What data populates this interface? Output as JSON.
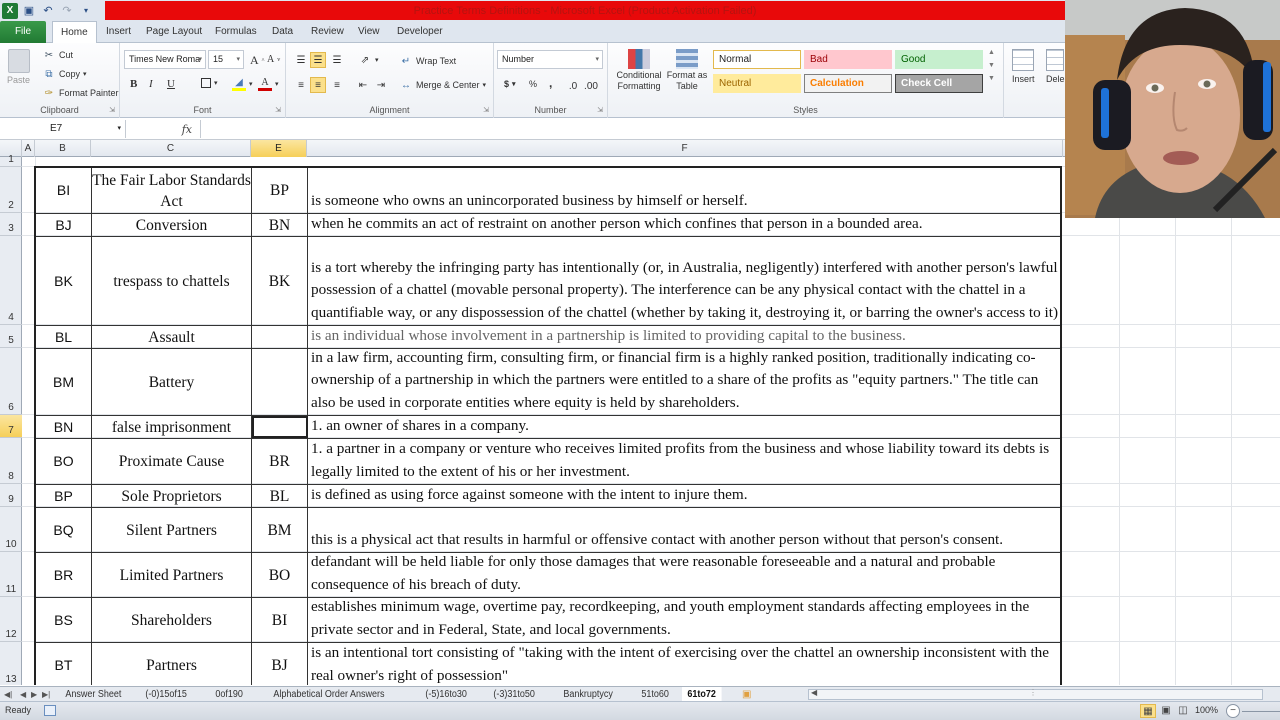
{
  "window": {
    "title": "Practice Terms Definitions - Microsoft Excel (Product Activation Failed)",
    "title_bar_color": "#e8090a"
  },
  "quick_access": {
    "icons": [
      "excel-logo-icon",
      "save-icon",
      "undo-icon",
      "redo-icon",
      "customize-icon"
    ]
  },
  "ribbon_tabs": [
    {
      "label": "File"
    },
    {
      "label": "Home"
    },
    {
      "label": "Insert"
    },
    {
      "label": "Page Layout"
    },
    {
      "label": "Formulas"
    },
    {
      "label": "Data"
    },
    {
      "label": "Review"
    },
    {
      "label": "View"
    },
    {
      "label": "Developer"
    }
  ],
  "ribbon": {
    "clipboard": {
      "label": "Clipboard",
      "paste": "Paste",
      "cut": "Cut",
      "copy": "Copy",
      "format_painter": "Format Painter"
    },
    "font": {
      "label": "Font",
      "font_name": "Times New Roma",
      "font_size": "15",
      "bold": "B",
      "italic": "I",
      "underline": "U"
    },
    "alignment": {
      "label": "Alignment",
      "wrap_text": "Wrap Text",
      "merge_center": "Merge & Center"
    },
    "number": {
      "label": "Number",
      "format": "Number",
      "currency": "$",
      "percent": "%",
      "comma": ","
    },
    "styles": {
      "label": "Styles",
      "conditional_formatting": "Conditional Formatting",
      "format_as_table": "Format as Table",
      "cells": [
        {
          "label": "Normal",
          "bg": "#ffffff",
          "fg": "#222222",
          "border": "#e3b94d"
        },
        {
          "label": "Bad",
          "bg": "#ffc7ce",
          "fg": "#9c0006",
          "border": "#ffc7ce"
        },
        {
          "label": "Good",
          "bg": "#c6efce",
          "fg": "#006100",
          "border": "#c6efce"
        },
        {
          "label": "Neutral",
          "bg": "#ffeb9c",
          "fg": "#9c6500",
          "border": "#ffeb9c"
        },
        {
          "label": "Calculation",
          "bg": "#f2f2f2",
          "fg": "#fa7d00",
          "border": "#7f7f7f"
        },
        {
          "label": "Check Cell",
          "bg": "#a5a5a5",
          "fg": "#ffffff",
          "border": "#3f3f3f"
        }
      ]
    },
    "cells": {
      "insert": "Insert",
      "delete": "Dele"
    }
  },
  "formula_bar": {
    "name_box": "E7",
    "fx": "fx",
    "content": ""
  },
  "columns": [
    {
      "label": "A",
      "selected": false
    },
    {
      "label": "B",
      "selected": false
    },
    {
      "label": "C",
      "selected": false
    },
    {
      "label": "E",
      "selected": true
    },
    {
      "label": "F",
      "selected": false
    }
  ],
  "rows": [
    {
      "num": "1",
      "selected": false
    },
    {
      "num": "2",
      "selected": false
    },
    {
      "num": "3",
      "selected": false
    },
    {
      "num": "4",
      "selected": false
    },
    {
      "num": "5",
      "selected": false
    },
    {
      "num": "6",
      "selected": false
    },
    {
      "num": "7",
      "selected": true
    },
    {
      "num": "8",
      "selected": false
    },
    {
      "num": "9",
      "selected": false
    },
    {
      "num": "10",
      "selected": false
    },
    {
      "num": "11",
      "selected": false
    },
    {
      "num": "12",
      "selected": false
    },
    {
      "num": "13",
      "selected": false
    }
  ],
  "table": [
    {
      "b": "BI",
      "c": "The Fair Labor Standards Act",
      "e": "BP",
      "f": " is someone who owns an unincorporated business by himself or herself.",
      "gray": false
    },
    {
      "b": "BJ",
      "c": "Conversion",
      "e": "BN",
      "f": "when he commits an act of restraint on another person which confines that person in a bounded area.",
      "gray": false
    },
    {
      "b": "BK",
      "c": "trespass to chattels",
      "e": "BK",
      "f": "is a tort whereby the infringing party has intentionally (or, in Australia, negligently) interfered with another person's lawful possession of a chattel (movable personal property). The interference can be any physical contact with the chattel in a quantifiable way, or any dispossession of the chattel (whether by taking it, destroying it, or barring the owner's access to it)",
      "gray": false
    },
    {
      "b": "BL",
      "c": "Assault",
      "e": "",
      "f": "is an individual whose involvement in a partnership is limited to providing capital to the business.",
      "gray": true
    },
    {
      "b": "BM",
      "c": "Battery",
      "e": "",
      "f": "in a law firm, accounting firm, consulting firm, or financial firm is a highly ranked position, traditionally indicating co-ownership of a partnership in which the partners were entitled to a share of the profits as \"equity partners.\" The title can also be used in corporate entities where equity is held by shareholders.",
      "gray": false
    },
    {
      "b": "BN",
      "c": "false imprisonment",
      "e": "",
      "f": "1. an owner of shares in a company.",
      "gray": false
    },
    {
      "b": "BO",
      "c": "Proximate Cause",
      "e": "BR",
      "f": "1. a partner in a company or venture who receives limited profits from the business and whose liability toward its debts is legally limited to the extent of his or her investment.",
      "gray": false
    },
    {
      "b": "BP",
      "c": "Sole Proprietors",
      "e": "BL",
      "f": "is defined as using force against someone with the intent to injure them.",
      "gray": false
    },
    {
      "b": "BQ",
      "c": "Silent Partners",
      "e": "BM",
      "f": " this is a physical act that results in harmful or offensive contact with another person without that person's consent.",
      "gray": false
    },
    {
      "b": "BR",
      "c": "Limited Partners",
      "e": "BO",
      "f": "defandant will be held liable for only those damages that were reasonable foreseeable and a natural and probable consequence of his breach of duty.",
      "gray": false
    },
    {
      "b": "BS",
      "c": "Shareholders",
      "e": "BI",
      "f": "establishes minimum wage, overtime pay, recordkeeping, and youth employment standards affecting employees in the private sector and in Federal, State, and local governments.",
      "gray": false
    },
    {
      "b": "BT",
      "c": "Partners",
      "e": "BJ",
      "f": "is an intentional tort consisting of \"taking with the intent of exercising over the chattel an ownership inconsistent with the real owner's right of possession\"",
      "gray": false
    }
  ],
  "sheet_tabs": [
    {
      "label": "Answer Sheet",
      "active": false
    },
    {
      "label": "(-0)15of15",
      "active": false
    },
    {
      "label": "0of190",
      "active": false
    },
    {
      "label": "Alphabetical Order Answers",
      "active": false
    },
    {
      "label": "(-5)16to30",
      "active": false
    },
    {
      "label": "(-3)31to50",
      "active": false
    },
    {
      "label": "Bankruptycy",
      "active": false
    },
    {
      "label": "51to60",
      "active": false
    },
    {
      "label": "61to72",
      "active": true
    }
  ],
  "status_bar": {
    "status": "Ready",
    "zoom": "100%"
  }
}
